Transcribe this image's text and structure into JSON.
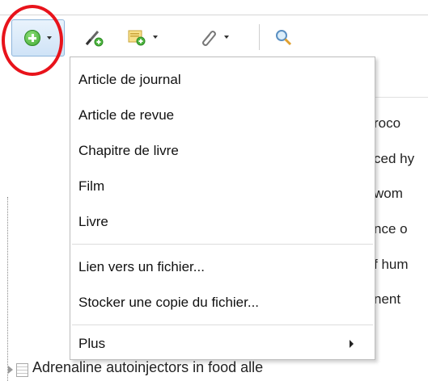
{
  "toolbar": {
    "new_item_icon": "add-circle-icon",
    "new_note_icon": "new-note-icon",
    "add_attachment_icon": "paperclip-icon",
    "search_icon": "search-icon"
  },
  "menu": {
    "items": [
      {
        "label": "Article de journal"
      },
      {
        "label": "Article de revue"
      },
      {
        "label": "Chapitre de livre"
      },
      {
        "label": "Film"
      },
      {
        "label": "Livre"
      },
      {
        "label": "Lien vers un fichier..."
      },
      {
        "label": "Stocker une copie du fichier..."
      },
      {
        "label": "Plus"
      }
    ]
  },
  "background_rows": [
    "roco",
    "ced hy",
    " wom",
    "nce o",
    "f hum",
    "nent"
  ],
  "bottom_row": {
    "label": "Adrenaline autoinjectors in food alle"
  },
  "colors": {
    "highlight": "#e8131b",
    "accent": "#8fb6dc"
  }
}
